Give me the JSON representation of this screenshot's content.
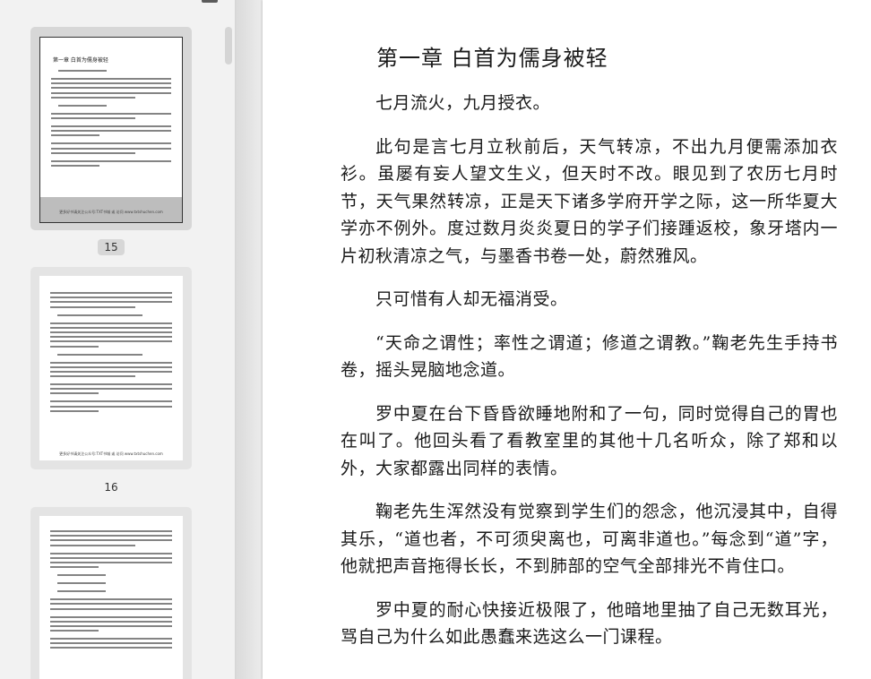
{
  "sidebar": {
    "thumbnails": [
      {
        "page_label": "15",
        "title": "第一章 白首为儒身被轻",
        "footnote": "更多好书请关注公众号:TXT书城 或 访问 www.txtshuchen.com"
      },
      {
        "page_label": "16",
        "footnote": "更多好书请关注公众号:TXT书城 或 访问 www.txtshuchen.com"
      },
      {
        "page_label": ""
      }
    ]
  },
  "document": {
    "title": "第一章 白首为儒身被轻",
    "paragraphs": [
      "七月流火，九月授衣。",
      "此句是言七月立秋前后，天气转凉，不出九月便需添加衣衫。虽屡有妄人望文生义，但天时不改。眼见到了农历七月时节，天气果然转凉，正是天下诸多学府开学之际，这一所华夏大学亦不例外。度过数月炎炎夏日的学子们接踵返校，象牙塔内一片初秋清凉之气，与墨香书卷一处，蔚然雅风。",
      "只可惜有人却无福消受。",
      "“天命之谓性；率性之谓道；修道之谓教。”鞠老先生手持书卷，摇头晃脑地念道。",
      "罗中夏在台下昏昏欲睡地附和了一句，同时觉得自己的胃也在叫了。他回头看了看教室里的其他十几名听众，除了郑和以外，大家都露出同样的表情。",
      "鞠老先生浑然没有觉察到学生们的怨念，他沉浸其中，自得其乐，“道也者，不可须臾离也，可离非道也。”每念到“道”字，他就把声音拖得长长，不到肺部的空气全部排光不肯住口。",
      "罗中夏的耐心快接近极限了，他暗地里抽了自己无数耳光，骂自己为什么如此愚蠢来选这么一门课程。"
    ]
  }
}
